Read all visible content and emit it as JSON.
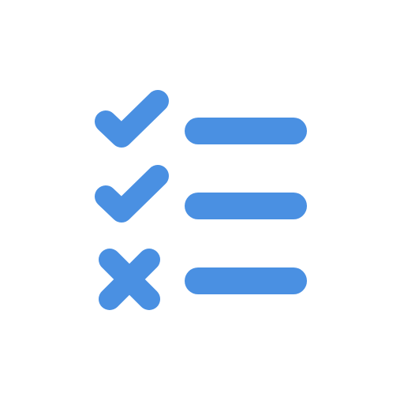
{
  "icon": {
    "name": "checklist-icon",
    "color": "#4A90E2",
    "background": "#FFFFFF",
    "rows": [
      {
        "status": "checked",
        "marker_icon": "checkmark-icon"
      },
      {
        "status": "checked",
        "marker_icon": "checkmark-icon"
      },
      {
        "status": "unchecked",
        "marker_icon": "cross-icon"
      }
    ]
  }
}
